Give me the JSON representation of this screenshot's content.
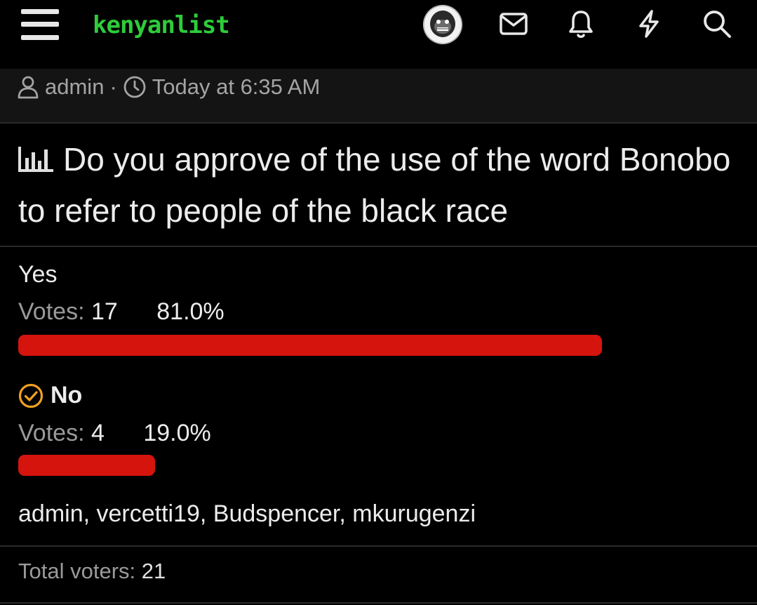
{
  "header": {
    "logo_text": "kenyanlist",
    "icons": [
      "menu-icon",
      "avatar",
      "mail-icon",
      "bell-icon",
      "bolt-icon",
      "search-icon"
    ]
  },
  "meta": {
    "author": "admin",
    "separator": "·",
    "time": "Today at 6:35 AM"
  },
  "poll": {
    "question": "Do you approve of the use of the word Bonobo to refer to people of the black race",
    "votes_label": "Votes:",
    "options": [
      {
        "label": "Yes",
        "votes": "17",
        "percent": "81.0%",
        "fraction": 0.81,
        "voted": false
      },
      {
        "label": "No",
        "votes": "4",
        "percent": "19.0%",
        "fraction": 0.19,
        "voted": true
      }
    ],
    "voters_list": "admin, vercetti19, Budspencer, mkurugenzi",
    "total_label": "Total voters:",
    "total_value": "21"
  },
  "colors": {
    "accent_green": "#2ecc3a",
    "bar_red": "#d5140d",
    "check_orange": "#f0a020",
    "background": "#000000"
  }
}
